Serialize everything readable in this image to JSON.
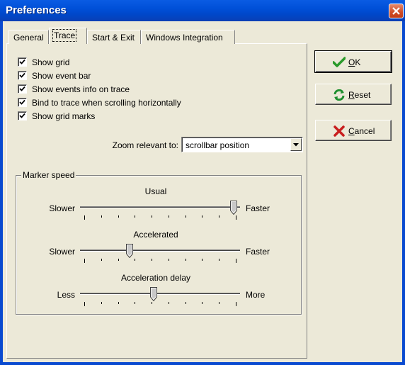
{
  "window": {
    "title": "Preferences"
  },
  "tabs": [
    {
      "label": "General"
    },
    {
      "label": "Trace"
    },
    {
      "label": "Start & Exit"
    },
    {
      "label": "Windows Integration"
    }
  ],
  "options": [
    {
      "label": "Show grid",
      "checked": true
    },
    {
      "label": "Show event bar",
      "checked": true
    },
    {
      "label": "Show events info on trace",
      "checked": true
    },
    {
      "label": "Bind to trace when scrolling horizontally",
      "checked": true
    },
    {
      "label": "Show grid marks",
      "checked": true
    }
  ],
  "zoom": {
    "label": "Zoom relevant to:",
    "value": "scrollbar position"
  },
  "marker_speed": {
    "title": "Marker speed",
    "sliders": [
      {
        "label": "Usual",
        "left": "Slower",
        "right": "Faster",
        "value": 1.0
      },
      {
        "label": "Accelerated",
        "left": "Slower",
        "right": "Faster",
        "value": 0.3
      },
      {
        "label": "Acceleration delay",
        "left": "Less",
        "right": "More",
        "value": 0.46
      }
    ]
  },
  "buttons": {
    "ok": {
      "mnemonic": "O",
      "rest": "K",
      "icon": "checkmark-icon"
    },
    "reset": {
      "mnemonic": "R",
      "rest": "eset",
      "icon": "refresh-icon"
    },
    "cancel": {
      "mnemonic": "C",
      "rest": "ancel",
      "icon": "x-icon"
    }
  },
  "colors": {
    "titlebar": "#0050d8",
    "face": "#ece9d8",
    "ok_green": "#2a9a2a",
    "reset_green": "#1f8f2f",
    "cancel_red": "#c81e1e"
  }
}
